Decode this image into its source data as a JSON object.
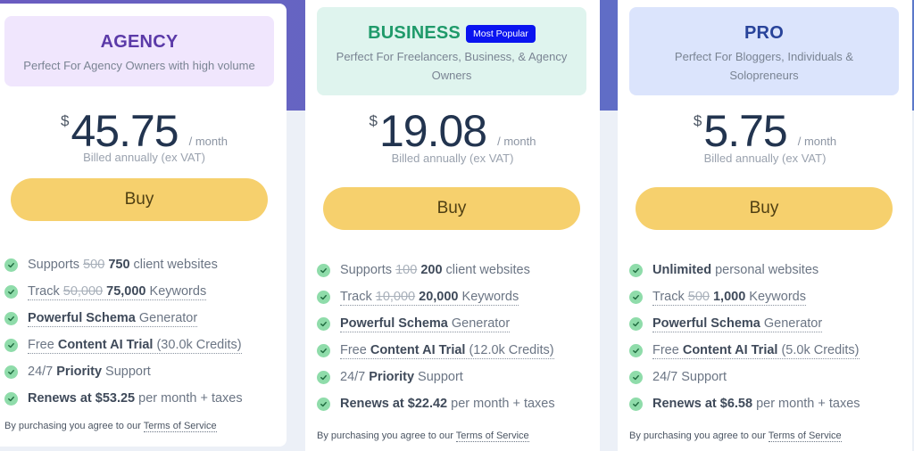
{
  "colors": {
    "agency_title": "#5b3aa8",
    "business_title": "#1f9a6a",
    "pro_title": "#28439a",
    "buy_button": "#f6d06d",
    "badge": "#0a14f0",
    "check": "#8fdcaa",
    "band": "#6565c2"
  },
  "plans": [
    {
      "id": "agency",
      "title": "AGENCY",
      "badge": null,
      "description": "Perfect For Agency Owners with high volume",
      "currency": "$",
      "price": "45.75",
      "period": "/ month",
      "billing": "Billed annually (ex VAT)",
      "buy_label": "Buy",
      "features": [
        {
          "icon": "check-icon",
          "parts": [
            {
              "t": "Supports "
            },
            {
              "t": "500",
              "s": true
            },
            {
              "t": " "
            },
            {
              "t": "750",
              "b": true
            },
            {
              "t": " client websites"
            }
          ],
          "dotted": false
        },
        {
          "icon": "check-icon",
          "parts": [
            {
              "t": "Track "
            },
            {
              "t": "50,000",
              "s": true
            },
            {
              "t": " "
            },
            {
              "t": "75,000",
              "b": true
            },
            {
              "t": " Keywords"
            }
          ],
          "dotted": true
        },
        {
          "icon": "check-icon",
          "parts": [
            {
              "t": "Powerful Schema",
              "b": true
            },
            {
              "t": " Generator"
            }
          ],
          "dotted": true
        },
        {
          "icon": "check-icon",
          "parts": [
            {
              "t": "Free "
            },
            {
              "t": "Content AI Trial",
              "b": true
            },
            {
              "t": " (30.0k Credits)"
            }
          ],
          "dotted": true
        },
        {
          "icon": "check-icon",
          "parts": [
            {
              "t": "24/7 "
            },
            {
              "t": "Priority",
              "b": true
            },
            {
              "t": " Support"
            }
          ],
          "dotted": false
        },
        {
          "icon": "check-icon",
          "parts": [
            {
              "t": "Renews at $53.25",
              "b": true
            },
            {
              "t": " per month + taxes"
            }
          ],
          "dotted": false
        }
      ],
      "terms_text": "By purchasing you agree to our ",
      "terms_link": "Terms of Service"
    },
    {
      "id": "business",
      "title": "BUSINESS",
      "badge": "Most Popular",
      "description": "Perfect For Freelancers, Business, & Agency Owners",
      "currency": "$",
      "price": "19.08",
      "period": "/ month",
      "billing": "Billed annually (ex VAT)",
      "buy_label": "Buy",
      "features": [
        {
          "icon": "check-icon",
          "parts": [
            {
              "t": "Supports "
            },
            {
              "t": "100",
              "s": true
            },
            {
              "t": " "
            },
            {
              "t": "200",
              "b": true
            },
            {
              "t": " client websites"
            }
          ],
          "dotted": false
        },
        {
          "icon": "check-icon",
          "parts": [
            {
              "t": "Track "
            },
            {
              "t": "10,000",
              "s": true
            },
            {
              "t": " "
            },
            {
              "t": "20,000",
              "b": true
            },
            {
              "t": " Keywords"
            }
          ],
          "dotted": true
        },
        {
          "icon": "check-icon",
          "parts": [
            {
              "t": "Powerful Schema",
              "b": true
            },
            {
              "t": " Generator"
            }
          ],
          "dotted": true
        },
        {
          "icon": "check-icon",
          "parts": [
            {
              "t": "Free "
            },
            {
              "t": "Content AI Trial",
              "b": true
            },
            {
              "t": " (12.0k Credits)"
            }
          ],
          "dotted": true
        },
        {
          "icon": "check-icon",
          "parts": [
            {
              "t": "24/7 "
            },
            {
              "t": "Priority",
              "b": true
            },
            {
              "t": " Support"
            }
          ],
          "dotted": false
        },
        {
          "icon": "check-icon",
          "parts": [
            {
              "t": "Renews at $22.42",
              "b": true
            },
            {
              "t": " per month + taxes"
            }
          ],
          "dotted": false
        }
      ],
      "terms_text": "By purchasing you agree to our ",
      "terms_link": "Terms of Service"
    },
    {
      "id": "pro",
      "title": "PRO",
      "badge": null,
      "description": "Perfect For Bloggers, Individuals & Solopreneurs",
      "currency": "$",
      "price": "5.75",
      "period": "/ month",
      "billing": "Billed annually (ex VAT)",
      "buy_label": "Buy",
      "features": [
        {
          "icon": "check-icon",
          "parts": [
            {
              "t": "Unlimited",
              "b": true
            },
            {
              "t": " personal websites"
            }
          ],
          "dotted": false
        },
        {
          "icon": "check-icon",
          "parts": [
            {
              "t": "Track "
            },
            {
              "t": "500",
              "s": true
            },
            {
              "t": " "
            },
            {
              "t": "1,000",
              "b": true
            },
            {
              "t": " Keywords"
            }
          ],
          "dotted": true
        },
        {
          "icon": "check-icon",
          "parts": [
            {
              "t": "Powerful Schema",
              "b": true
            },
            {
              "t": " Generator"
            }
          ],
          "dotted": true
        },
        {
          "icon": "check-icon",
          "parts": [
            {
              "t": "Free "
            },
            {
              "t": "Content AI Trial",
              "b": true
            },
            {
              "t": " (5.0k Credits)"
            }
          ],
          "dotted": true
        },
        {
          "icon": "check-icon",
          "parts": [
            {
              "t": "24/7 Support"
            }
          ],
          "dotted": false
        },
        {
          "icon": "check-icon",
          "parts": [
            {
              "t": "Renews at $6.58",
              "b": true
            },
            {
              "t": " per month + taxes"
            }
          ],
          "dotted": false
        }
      ],
      "terms_text": "By purchasing you agree to our ",
      "terms_link": "Terms of Service"
    }
  ]
}
